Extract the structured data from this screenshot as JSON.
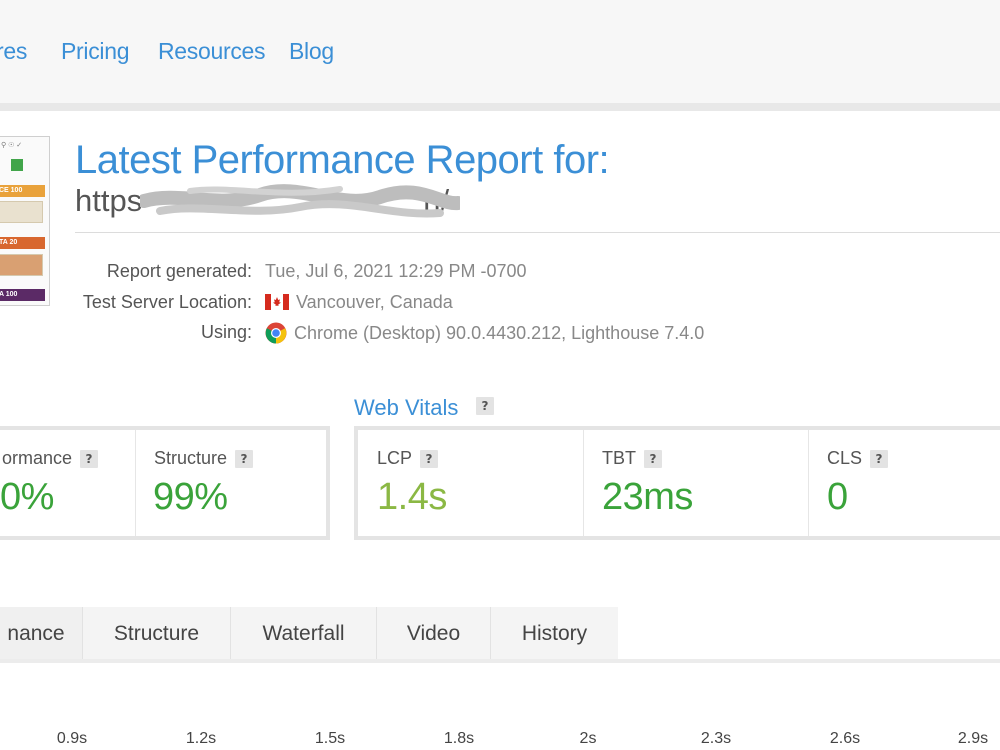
{
  "nav": {
    "items": [
      "res",
      "Pricing",
      "Resources",
      "Blog"
    ]
  },
  "report": {
    "title": "Latest Performance Report for:",
    "url_prefix": "https",
    "url_suffix": "n/",
    "thumbnail": {
      "labels": [
        "CE 100",
        "TA 20",
        "A 100"
      ]
    },
    "meta": [
      {
        "label": "Report generated:",
        "value": "Tue, Jul 6, 2021 12:29 PM -0700"
      },
      {
        "label": "Test Server Location:",
        "value": "Vancouver, Canada",
        "icon": "canada-flag-icon"
      },
      {
        "label": "Using:",
        "value": "Chrome (Desktop) 90.0.4430.212, Lighthouse 7.4.0",
        "icon": "chrome-icon"
      }
    ]
  },
  "grades": {
    "performance_label": "ormance",
    "performance_value": "0%",
    "structure_label": "Structure",
    "structure_value": "99%"
  },
  "web_vitals": {
    "title": "Web Vitals",
    "help": "?",
    "metrics": [
      {
        "label": "LCP",
        "value": "1.4s",
        "color": "#8bb844"
      },
      {
        "label": "TBT",
        "value": "23ms",
        "color": "#3aa33a"
      },
      {
        "label": "CLS",
        "value": "0",
        "color": "#3aa33a"
      }
    ]
  },
  "tabs": [
    "nance",
    "Structure",
    "Waterfall",
    "Video",
    "History"
  ],
  "timeline": {
    "ticks": [
      "0.9s",
      "1.2s",
      "1.5s",
      "1.8s",
      "2s",
      "2.3s",
      "2.6s",
      "2.9s"
    ]
  },
  "colors": {
    "accent": "#3b8fd6",
    "good": "#3aa33a",
    "ok": "#8bb844"
  }
}
